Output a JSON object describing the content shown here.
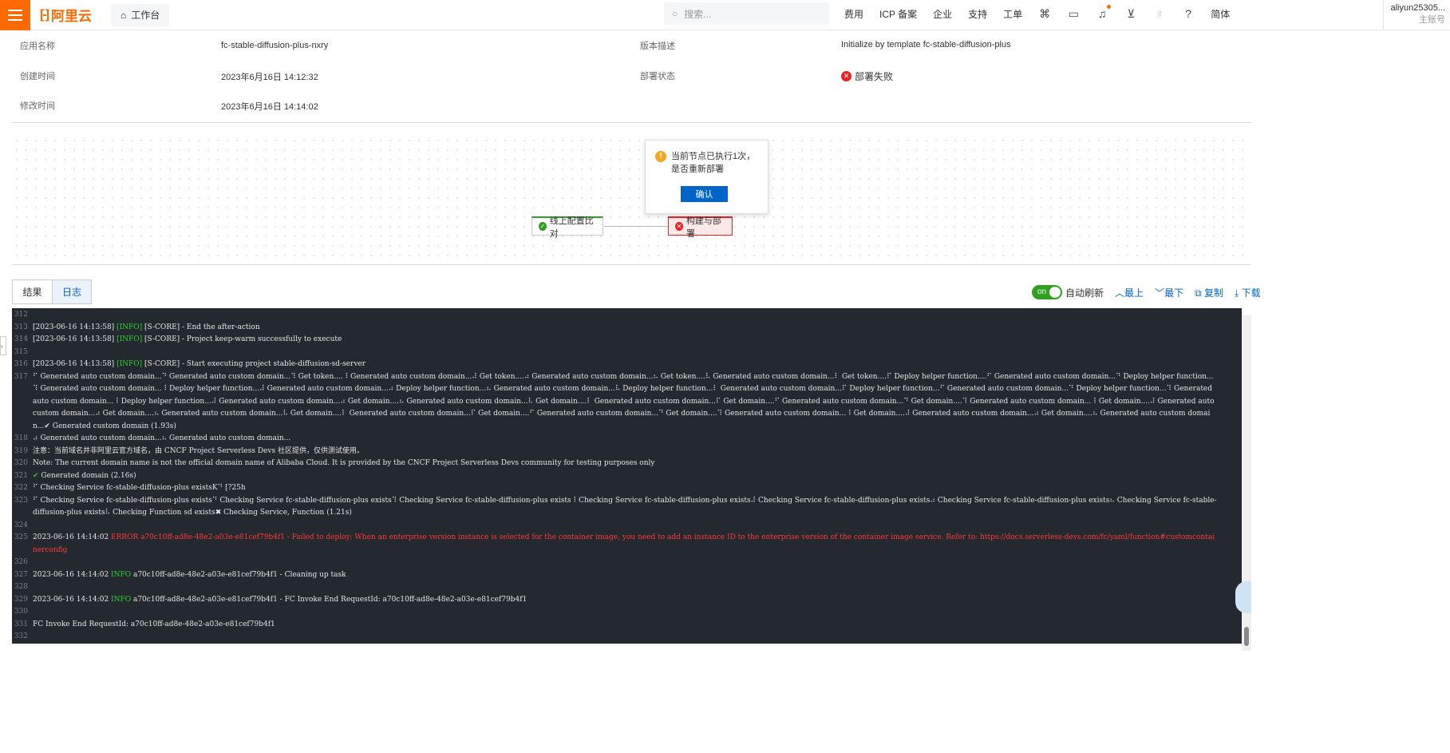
{
  "topbar": {
    "logo_text": "阿里云",
    "logo_mark": "[-]",
    "workbench_label": "工作台",
    "search_placeholder": "搜索...",
    "nav": [
      "费用",
      "ICP 备案",
      "企业",
      "支持",
      "工单"
    ],
    "lang": "简体",
    "account_name": "aliyun25305...",
    "account_sub": "主账号"
  },
  "info": {
    "app_name_label": "应用名称",
    "app_name": "fc-stable-diffusion-plus-nxry",
    "created_label": "创建时间",
    "created": "2023年6月16日 14:12:32",
    "modified_label": "修改时间",
    "modified": "2023年6月16日 14:14:02",
    "version_desc_label": "版本描述",
    "version_desc": "Initialize by template fc-stable-diffusion-plus",
    "deploy_status_label": "部署状态",
    "deploy_status": "部署失败"
  },
  "flow": {
    "node_ok": "线上配置比对",
    "node_fail": "构建与部署",
    "popup_msg": "当前节点已执行1次，是否重新部署",
    "popup_btn": "确认"
  },
  "tabs": {
    "result": "结果",
    "log": "日志"
  },
  "toolbar": {
    "toggle": "on",
    "auto_refresh": "自动刷新",
    "top": "最上",
    "bottom": "最下",
    "copy": "复制",
    "download": "下载"
  },
  "log": [
    {
      "n": "312",
      "t": ""
    },
    {
      "n": "313",
      "pre": "[2023-06-16 14:13:58] ",
      "lvl": "[INFO]",
      "post": " [S-CORE] - End the after-action"
    },
    {
      "n": "314",
      "pre": "[2023-06-16 14:13:58] ",
      "lvl": "[INFO]",
      "post": " [S-CORE] - Project keep-warm successfully to execute"
    },
    {
      "n": "315",
      "t": ""
    },
    {
      "n": "316",
      "pre": "[2023-06-16 14:13:58] ",
      "lvl": "[INFO]",
      "post": " [S-CORE] - Start executing project stable-diffusion-sd-server"
    },
    {
      "n": "317",
      "t": "⠋ Generated auto custom domain...⠙ Generated auto custom domain...⠹ Get token....⠸ Generated auto custom domain...⠼ Get token....⠴ Generated auto custom domain...⠦ Get token....⠧ Generated auto custom domain...⠇ Get token....⠏ Deploy helper function....⠋ Generated auto custom domain...⠙ Deploy helper function...⠹ Generated auto custom domain...⠸ Deploy helper function...⠼ Generated auto custom domain...⠴ Deploy helper function...⠦ Generated auto custom domain...⠧ Deploy helper function...⠇ Generated auto custom domain...⠏ Deploy helper function...⠋ Generated auto custom domain...⠙ Deploy helper function...⠹ Generated auto custom domain...⠸ Deploy helper function...⠼ Generated auto custom domain...⠴ Get domain....⠦ Generated auto custom domain...⠧ Get domain....⠇ Generated auto custom domain...⠏ Get domain....⠋ Generated auto custom domain...⠙ Get domain....⠹ Generated auto custom domain...⠸ Get domain....⠼ Generated auto custom domain...⠴ Get domain....⠦ Generated auto custom domain...⠧ Get domain....⠇ Generated auto custom domain...⠏ Get domain....⠋ Generated auto custom domain...⠙ Get domain....⠹ Generated auto custom domain...⠸ Get domain....⠼ Generated auto custom domain...⠴ Get domain....⠦ Generated auto custom domain...✔ Generated custom domain (1.93s)"
    },
    {
      "n": "318",
      "t": "⠴ Generated auto custom domain...⠦ Generated auto custom domain..."
    },
    {
      "n": "319",
      "t": "注意：当前域名并非阿里云官方域名，由 CNCF Project Serverless Devs 社区提供，仅供测试使用。"
    },
    {
      "n": "320",
      "t": "Note: The current domain name is not the official domain name of Alibaba Cloud. It is provided by the CNCF Project Serverless Devs community for testing purposes only"
    },
    {
      "n": "321",
      "t": "✔ Generated domain (2.16s)",
      "ok": true
    },
    {
      "n": "322",
      "t": "⠋ Checking Service fc-stable-diffusion-plus existsK⠙ [?25h"
    },
    {
      "n": "323",
      "t": "⠋ Checking Service fc-stable-diffusion-plus exists⠙ Checking Service fc-stable-diffusion-plus exists⠹ Checking Service fc-stable-diffusion-plus exists⠸ Checking Service fc-stable-diffusion-plus exists⠼ Checking Service fc-stable-diffusion-plus exists⠴ Checking Service fc-stable-diffusion-plus exists⠦ Checking Service fc-stable-diffusion-plus exists⠧ Checking Function sd exists✖ Checking Service, Function (1.21s)"
    },
    {
      "n": "324",
      "t": ""
    },
    {
      "n": "325",
      "pre": "2023-06-16 14:14:02 ",
      "lvl": "ERROR",
      "post": " a70c10ff-ad8e-48e2-a03e-e81cef79b4f1 - Failed to deploy: When an enterprise version instance is selected for the container image, you need to add an instance ID to the enterprise version of the container image service. Refer to: https://docs.serverless-devs.com/fc/yaml/function#customcontainerconfig",
      "err": true
    },
    {
      "n": "326",
      "t": ""
    },
    {
      "n": "327",
      "pre": "2023-06-16 14:14:02 ",
      "lvl": "INFO",
      "post": " a70c10ff-ad8e-48e2-a03e-e81cef79b4f1 - Cleaning up task"
    },
    {
      "n": "328",
      "t": ""
    },
    {
      "n": "329",
      "pre": "2023-06-16 14:14:02 ",
      "lvl": "INFO",
      "post": " a70c10ff-ad8e-48e2-a03e-e81cef79b4f1 - FC Invoke End RequestId: a70c10ff-ad8e-48e2-a03e-e81cef79b4f1"
    },
    {
      "n": "330",
      "t": ""
    },
    {
      "n": "331",
      "t": "FC Invoke End RequestId: a70c10ff-ad8e-48e2-a03e-e81cef79b4f1"
    },
    {
      "n": "332",
      "t": ""
    }
  ]
}
